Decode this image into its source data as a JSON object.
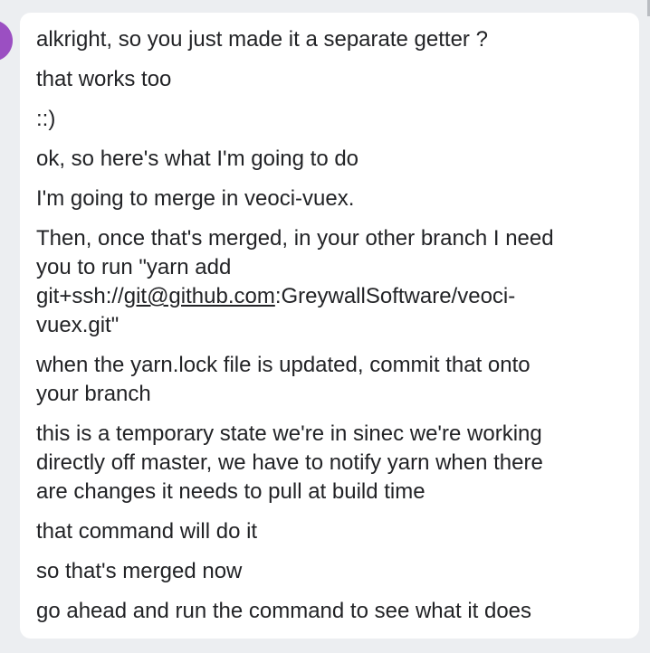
{
  "chat": {
    "messages": [
      {
        "text": "alkright, so you just made it a separate getter ?"
      },
      {
        "text": "that works too"
      },
      {
        "text": "::)"
      },
      {
        "text": "ok, so here's what I'm going to do"
      },
      {
        "text": "I'm going to merge in veoci-vuex."
      },
      {
        "line1": "Then, once that's merged, in your other branch I need",
        "line2": "you to run \"yarn add",
        "line3_prefix": "git+ssh://",
        "link": "git@github.com",
        "line3_suffix": ":GreywallSoftware/veoci-",
        "line4": "vuex.git\""
      },
      {
        "text": "when the yarn.lock file is updated, commit that onto\nyour branch"
      },
      {
        "text": "this is a temporary state we're in sinec we're working\ndirectly off master, we have to notify yarn when there\nare changes it needs to pull at build time"
      },
      {
        "text": "that command will do it"
      },
      {
        "text": "so that's merged now"
      },
      {
        "text": "go ahead and run the command to see what it does"
      }
    ]
  },
  "colors": {
    "background": "#eceef1",
    "bubble": "#ffffff",
    "text": "#222326",
    "avatar": "#9b4fc2"
  }
}
